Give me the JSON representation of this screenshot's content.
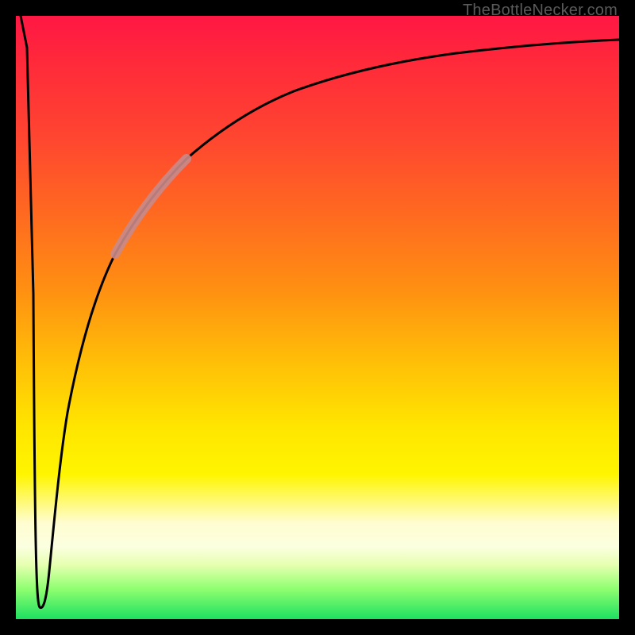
{
  "attribution": "TheBottleNecker.com",
  "colors": {
    "frame": "#000000",
    "curve": "#000000",
    "highlight": "#c98a8a",
    "gradient_top": "#ff1744",
    "gradient_bottom": "#1de060"
  },
  "chart_data": {
    "type": "line",
    "title": "",
    "xlabel": "",
    "ylabel": "",
    "xlim": [
      0,
      100
    ],
    "ylim": [
      0,
      100
    ],
    "series": [
      {
        "name": "bottleneck-curve",
        "x": [
          0,
          2,
          3,
          4,
          5,
          6,
          8,
          10,
          13,
          16,
          20,
          25,
          30,
          40,
          50,
          60,
          75,
          90,
          100
        ],
        "y": [
          100,
          50,
          5,
          2,
          10,
          30,
          45,
          55,
          64,
          70,
          75,
          80,
          83,
          87,
          89.5,
          91,
          92.5,
          93.5,
          94
        ]
      },
      {
        "name": "highlight-segment",
        "x": [
          16,
          18,
          20,
          22,
          25
        ],
        "y": [
          70,
          73,
          75,
          77.5,
          80
        ]
      }
    ],
    "annotations": []
  }
}
